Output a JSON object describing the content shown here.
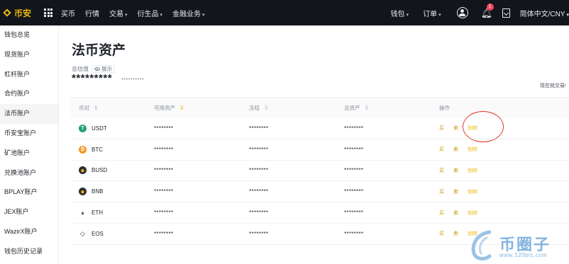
{
  "topbar": {
    "logo_text": "币安",
    "nav": [
      {
        "label": "买币",
        "caret": ""
      },
      {
        "label": "行情",
        "caret": ""
      },
      {
        "label": "交易",
        "caret": "▾"
      },
      {
        "label": "衍生品",
        "caret": "▾"
      },
      {
        "label": "金融业务",
        "caret": "▾"
      }
    ],
    "wallet_label": "钱包",
    "orders_label": "订单",
    "caret": "▾",
    "notification_count": "1",
    "language": "简体中文/CNY",
    "language_caret": "▾"
  },
  "sidebar": {
    "items": [
      {
        "label": "钱包总览",
        "active": false
      },
      {
        "label": "现货账户",
        "active": false
      },
      {
        "label": "杠杆账户",
        "active": false
      },
      {
        "label": "合约账户",
        "active": false
      },
      {
        "label": "法币账户",
        "active": true
      },
      {
        "label": "币安宝账户",
        "active": false
      },
      {
        "label": "矿池账户",
        "active": false
      },
      {
        "label": "兑换池账户",
        "active": false
      },
      {
        "label": "BPLAY账户",
        "active": false
      },
      {
        "label": "JEX账户",
        "active": false
      },
      {
        "label": "WazirX账户",
        "active": false
      },
      {
        "label": "钱包历史记录",
        "active": false
      }
    ]
  },
  "main": {
    "title": "法币资产",
    "estimated_label": "总估值",
    "show_label": "展示",
    "balance_mask": "*********",
    "balance_fiat_mask": "**********",
    "right_link": "现在就交易!",
    "table": {
      "headers": {
        "coin": "币对",
        "available": "可用资产",
        "frozen": "冻结",
        "total": "总资产",
        "ops": "操作"
      },
      "sort_glyph": "⇕",
      "rows": [
        {
          "coin": "USDT",
          "icon_color": "#26a17b",
          "icon_glyph": "T",
          "icon_name": "usdt-icon",
          "available": "********",
          "frozen": "********",
          "total": "********"
        },
        {
          "coin": "BTC",
          "icon_color": "#f7931a",
          "icon_glyph": "₿",
          "icon_name": "btc-icon",
          "available": "********",
          "frozen": "********",
          "total": "********"
        },
        {
          "coin": "BUSD",
          "icon_color": "#2b2f36",
          "icon_glyph": "◆",
          "icon_name": "busd-icon",
          "available": "********",
          "frozen": "********",
          "total": "********"
        },
        {
          "coin": "BNB",
          "icon_color": "#2b2f36",
          "icon_glyph": "◆",
          "icon_name": "bnb-icon",
          "available": "********",
          "frozen": "********",
          "total": "********"
        },
        {
          "coin": "ETH",
          "icon_color": "#ffffff",
          "icon_glyph": "♦",
          "icon_name": "eth-icon",
          "available": "********",
          "frozen": "********",
          "total": "********"
        },
        {
          "coin": "EOS",
          "icon_color": "#ffffff",
          "icon_glyph": "◇",
          "icon_name": "eos-icon",
          "available": "********",
          "frozen": "********",
          "total": "********"
        }
      ],
      "ops": {
        "buy": "买",
        "sell": "卖",
        "transfer": "划转"
      }
    }
  },
  "watermark": {
    "title": "币圈子",
    "url": "www.120btc.com"
  },
  "colors": {
    "accent": "#f0b90b",
    "highlight_circle": "#e03a2c",
    "watermark": "#5b9bd5"
  }
}
